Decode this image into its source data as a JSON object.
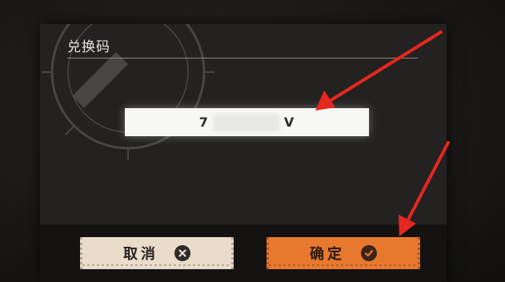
{
  "dialog": {
    "title": "兑换码",
    "code_prefix": "7",
    "code_suffix": "V"
  },
  "buttons": {
    "cancel_label": "取消",
    "cancel_icon": "close-icon",
    "confirm_label": "确定",
    "confirm_icon": "check-icon"
  },
  "colors": {
    "cancel_bg": "#e9dccb",
    "confirm_bg": "#e9782f",
    "annotation_arrow": "#e5271f"
  }
}
